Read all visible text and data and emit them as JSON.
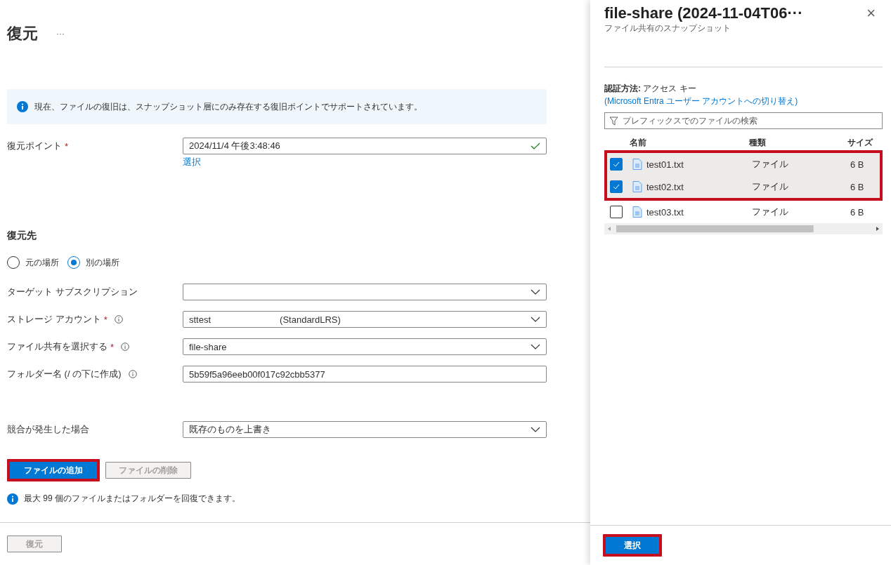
{
  "page": {
    "title": "復元",
    "more": "···"
  },
  "info_banner": {
    "text": "現在、ファイルの復旧は、スナップショット層にのみ存在する復旧ポイントでサポートされています。"
  },
  "restore_point": {
    "label": "復元ポイント",
    "required_mark": "*",
    "value": "2024/11/4 午後3:48:46",
    "valid": true,
    "link": "選択"
  },
  "destination": {
    "heading": "復元先",
    "options": [
      {
        "label": "元の場所",
        "selected": false
      },
      {
        "label": "別の場所",
        "selected": true
      }
    ]
  },
  "fields": [
    {
      "kind": "select",
      "label": "ターゲット サブスクリプション"
    },
    {
      "kind": "select",
      "label": "ストレージ アカウント",
      "required_mark": "*",
      "info": true,
      "value": "sttest",
      "detail": "(StandardLRS)"
    },
    {
      "kind": "select",
      "label": "ファイル共有を選択する",
      "required_mark": "*",
      "info": true,
      "value": "file-share"
    },
    {
      "kind": "text",
      "label": "フォルダー名 (/ の下に作成)",
      "info": true,
      "value": "5b59f5a96eeb00f017c92cbb5377"
    }
  ],
  "conflict": {
    "kind": "select",
    "label": "競合が発生した場合",
    "value": "既存のものを上書き"
  },
  "file_buttons": [
    {
      "label": "ファイルの追加",
      "disabled": false,
      "highlighted": true
    },
    {
      "label": "ファイルの削除",
      "disabled": true,
      "highlighted": false
    }
  ],
  "note": "最大 99 個のファイルまたはフォルダーを回復できます。",
  "footer_button": {
    "label": "復元",
    "disabled": true
  },
  "panel": {
    "title": "file-share (2024-11-04T06···",
    "subtitle": "ファイル共有のスナップショット",
    "close": "×",
    "auth_label": "認証方法:",
    "auth_value": "アクセス キー",
    "auth_link": "(Microsoft Entra ユーザー アカウントへの切り替え)",
    "search": {
      "placeholder": "プレフィックスでのファイルの検索"
    },
    "columns": [
      "名前",
      "種類",
      "サイズ"
    ],
    "rows": [
      {
        "name": "test01.txt",
        "type": "ファイル",
        "size": "6 B",
        "checked": true,
        "highlighted": true
      },
      {
        "name": "test02.txt",
        "type": "ファイル",
        "size": "6 B",
        "checked": true,
        "highlighted": true
      },
      {
        "name": "test03.txt",
        "type": "ファイル",
        "size": "6 B",
        "checked": false,
        "highlighted": false
      }
    ],
    "select_button": {
      "label": "選択",
      "highlighted": true
    }
  }
}
